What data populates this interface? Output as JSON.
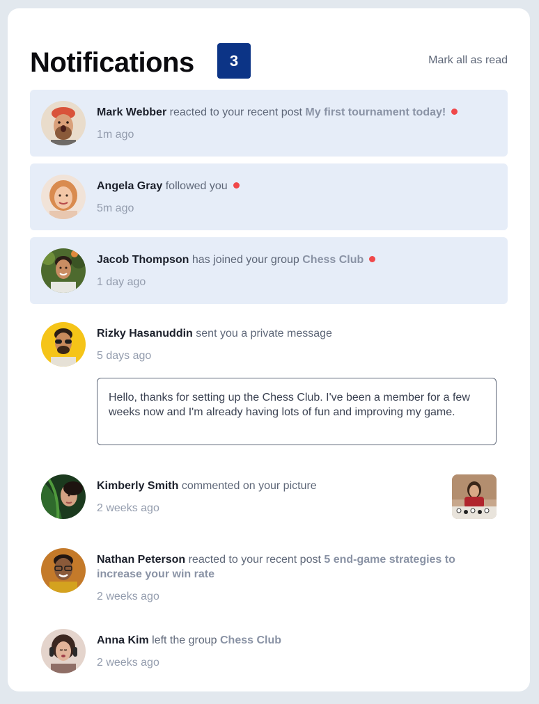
{
  "header": {
    "title": "Notifications",
    "unread_count": "3",
    "mark_all_label": "Mark all as read"
  },
  "notifications": [
    {
      "name": "Mark Webber",
      "action": "reacted to your recent post",
      "target": "My first tournament today!",
      "time": "1m ago",
      "unread": true
    },
    {
      "name": "Angela Gray",
      "action": "followed you",
      "target": "",
      "time": "5m ago",
      "unread": true
    },
    {
      "name": "Jacob Thompson",
      "action": "has joined your group",
      "target": "Chess Club",
      "time": "1 day ago",
      "unread": true
    },
    {
      "name": "Rizky Hasanuddin",
      "action": "sent you a private message",
      "target": "",
      "time": "5 days ago",
      "unread": false,
      "message": "Hello, thanks for setting up the Chess Club. I've been a member for a few weeks now and I'm already having lots of fun and improving my game."
    },
    {
      "name": "Kimberly Smith",
      "action": "commented on your picture",
      "target": "",
      "time": "2 weeks ago",
      "unread": false
    },
    {
      "name": "Nathan Peterson",
      "action": "reacted to your recent post",
      "target": "5 end-game strategies to increase your win rate",
      "time": "2 weeks ago",
      "unread": false
    },
    {
      "name": "Anna Kim",
      "action": "left the group",
      "target": "Chess Club",
      "time": "2 weeks ago",
      "unread": false
    }
  ],
  "colors": {
    "unread_bg": "#e6edf8",
    "badge_bg": "#0c3486",
    "unread_dot": "#f0484a",
    "name_text": "#1c202b",
    "target_text": "#8a93a5"
  }
}
